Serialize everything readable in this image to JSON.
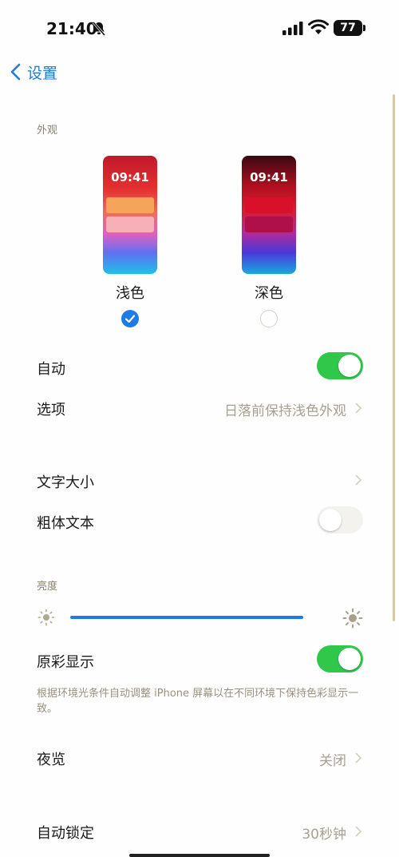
{
  "status_bar": {
    "time": "21:40",
    "battery": "77"
  },
  "nav": {
    "back_label": "设置"
  },
  "appearance": {
    "header": "外观",
    "light": {
      "preview_time": "09:41",
      "label": "浅色",
      "selected": true
    },
    "dark": {
      "preview_time": "09:41",
      "label": "深色",
      "selected": false
    }
  },
  "rows": {
    "auto": {
      "label": "自动",
      "on": true
    },
    "options": {
      "label": "选项",
      "value": "日落前保持浅色外观"
    },
    "text_size": {
      "label": "文字大小"
    },
    "bold_text": {
      "label": "粗体文本",
      "on": false
    },
    "true_tone": {
      "label": "原彩显示",
      "on": true
    },
    "night_shift": {
      "label": "夜览",
      "value": "关闭"
    },
    "auto_lock": {
      "label": "自动锁定",
      "value": "30秒钟"
    }
  },
  "brightness": {
    "header": "亮度",
    "level": 0.85
  },
  "true_tone_note": "根据环境光条件自动调整 iPhone 屏幕以在不同环境下保持色彩显示一致。",
  "colors": {
    "accent": "#1e7be6",
    "toggle_on": "#2fc84a"
  }
}
